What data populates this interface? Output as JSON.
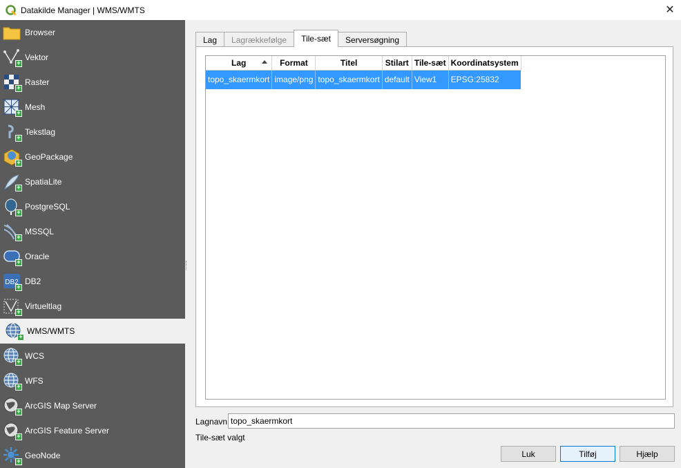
{
  "window": {
    "title": "Datakilde Manager | WMS/WMTS"
  },
  "sidebar": {
    "items": [
      {
        "label": "Browser",
        "icon": "folder-icon"
      },
      {
        "label": "Vektor",
        "icon": "vector-icon"
      },
      {
        "label": "Raster",
        "icon": "raster-icon"
      },
      {
        "label": "Mesh",
        "icon": "mesh-icon"
      },
      {
        "label": "Tekstlag",
        "icon": "delimited-text-icon"
      },
      {
        "label": "GeoPackage",
        "icon": "geopackage-icon"
      },
      {
        "label": "SpatiaLite",
        "icon": "spatialite-icon"
      },
      {
        "label": "PostgreSQL",
        "icon": "postgresql-icon"
      },
      {
        "label": "MSSQL",
        "icon": "mssql-icon"
      },
      {
        "label": "Oracle",
        "icon": "oracle-icon"
      },
      {
        "label": "DB2",
        "icon": "db2-icon"
      },
      {
        "label": "Virtueltlag",
        "icon": "virtual-layer-icon"
      },
      {
        "label": "WMS/WMTS",
        "icon": "wms-globe-icon"
      },
      {
        "label": "WCS",
        "icon": "wcs-globe-icon"
      },
      {
        "label": "WFS",
        "icon": "wfs-globe-icon"
      },
      {
        "label": "ArcGIS Map Server",
        "icon": "arcgis-map-icon"
      },
      {
        "label": "ArcGIS Feature Server",
        "icon": "arcgis-feature-icon"
      },
      {
        "label": "GeoNode",
        "icon": "geonode-icon"
      }
    ],
    "active_index": 12
  },
  "tabs": [
    {
      "label": "Lag"
    },
    {
      "label": "Lagrækkefølge"
    },
    {
      "label": "Tile-sæt"
    },
    {
      "label": "Serversøgning"
    }
  ],
  "table": {
    "columns": [
      "Lag",
      "Format",
      "Titel",
      "Stilart",
      "Tile-sæt",
      "Koordinatsystem"
    ],
    "rows": [
      [
        "topo_skaermkort",
        "image/png",
        "topo_skaermkort",
        "default",
        "View1",
        "EPSG:25832"
      ]
    ]
  },
  "form": {
    "lagnavn_label": "Lagnavn",
    "lagnavn_value": "topo_skaermkort",
    "status": "Tile-sæt valgt"
  },
  "buttons": {
    "close": "Luk",
    "add": "Tilføj",
    "help": "Hjælp"
  },
  "colors": {
    "sidebar_bg": "#5b5b5b",
    "selection": "#3399ff",
    "plus_badge": "#3aa648"
  }
}
